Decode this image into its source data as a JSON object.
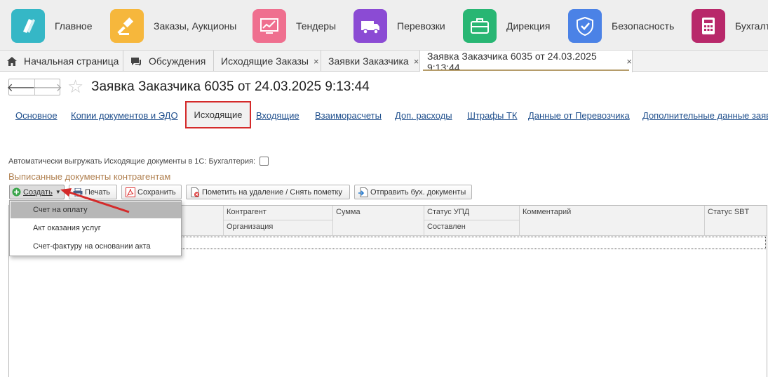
{
  "sections": [
    {
      "label": "Главное",
      "icon": "main-section-icon",
      "color": "#35b7c6"
    },
    {
      "label": "Заказы, Аукционы",
      "icon": "gavel-icon",
      "color": "#f6b73c"
    },
    {
      "label": "Тендеры",
      "icon": "chart-monitor-icon",
      "color": "#ef6f8f"
    },
    {
      "label": "Перевозки",
      "icon": "truck-icon",
      "color": "#8b4bd4"
    },
    {
      "label": "Дирекция",
      "icon": "briefcase-icon",
      "color": "#28b673"
    },
    {
      "label": "Безопасность",
      "icon": "shield-icon",
      "color": "#4b82e6"
    },
    {
      "label": "Бухгалт",
      "icon": "calculator-icon",
      "color": "#b8286a"
    }
  ],
  "window_tabs": [
    {
      "label": "Начальная страница"
    },
    {
      "label": "Обсуждения"
    },
    {
      "label": "Исходящие Заказы"
    },
    {
      "label": "Заявки Заказчика"
    },
    {
      "label": "Заявка Заказчика 6035 от 24.03.2025 9:13:44"
    }
  ],
  "close_glyph": "×",
  "nav": {
    "back": "🡐",
    "forward": "🡒",
    "star": "☆"
  },
  "page_title": "Заявка Заказчика 6035 от 24.03.2025 9:13:44",
  "form_tabs": [
    "Основное",
    "Копии документов и ЭДО",
    "Исходящие",
    "Входящие",
    "Взаиморасчеты",
    "Доп. расходы",
    "Штрафы ТК",
    "Данные от Перевозчика",
    "Дополнительные данные заяв"
  ],
  "auto_export_label": "Автоматически выгружать Исходящие документы в 1С: Бухгалтерия:",
  "auto_export_checked": false,
  "group_title": "Выписанные документы контрагентам",
  "commands": {
    "create": "Создать",
    "print": "Печать",
    "save": "Сохранить",
    "mark_delete": "Пометить на удаление / Снять пометку",
    "send": "Отправить бух. документы"
  },
  "table": {
    "col_counterparty": "Контрагент",
    "col_organization": "Организация",
    "col_sum": "Сумма",
    "col_upd_status": "Статус УПД",
    "col_upd_status_sub": "Составлен",
    "col_comment": "Комментарий",
    "col_sbt_status": "Статус SBT"
  },
  "create_menu": [
    {
      "label": "Счет на оплату"
    },
    {
      "label": "Акт оказания услуг"
    },
    {
      "label": "Счет-фактуру на основании акта"
    }
  ],
  "colors": {
    "accent_tab": "#b59c6a",
    "highlight": "#d42a2a",
    "link": "#1e4e8c"
  }
}
